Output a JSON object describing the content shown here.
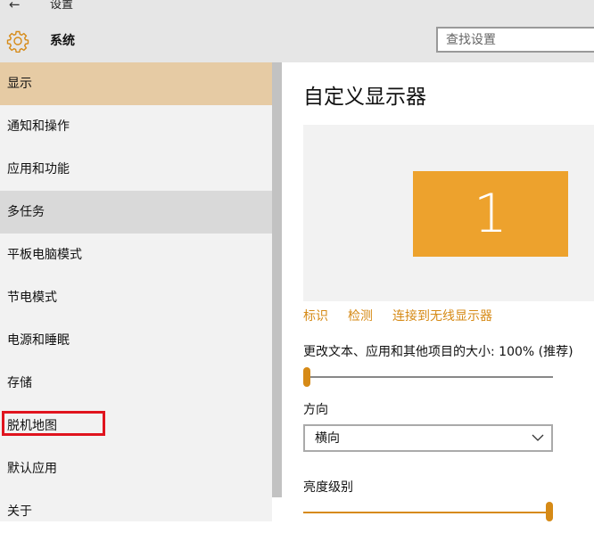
{
  "window": {
    "title": "设置",
    "back_icon": "←"
  },
  "header": {
    "section": "系统",
    "search_placeholder": "查找设置"
  },
  "sidebar": {
    "items": [
      {
        "label": "显示"
      },
      {
        "label": "通知和操作"
      },
      {
        "label": "应用和功能"
      },
      {
        "label": "多任务"
      },
      {
        "label": "平板电脑模式"
      },
      {
        "label": "节电模式"
      },
      {
        "label": "电源和睡眠"
      },
      {
        "label": "存储"
      },
      {
        "label": "脱机地图"
      },
      {
        "label": "默认应用"
      },
      {
        "label": "关于"
      }
    ]
  },
  "main": {
    "title": "自定义显示器",
    "monitor_number": "1",
    "links": {
      "identify": "标识",
      "detect": "检测",
      "connect": "连接到无线显示器"
    },
    "scale_label": "更改文本、应用和其他项目的大小: 100% (推荐)",
    "scale_level": 0,
    "orientation_label": "方向",
    "orientation_value": "横向",
    "brightness_label": "亮度级别",
    "brightness_level": 1
  },
  "colors": {
    "accent": "#d68a16",
    "monitor": "#eda22d",
    "active_nav": "#e6cba4",
    "annotation": "#e0141e"
  }
}
